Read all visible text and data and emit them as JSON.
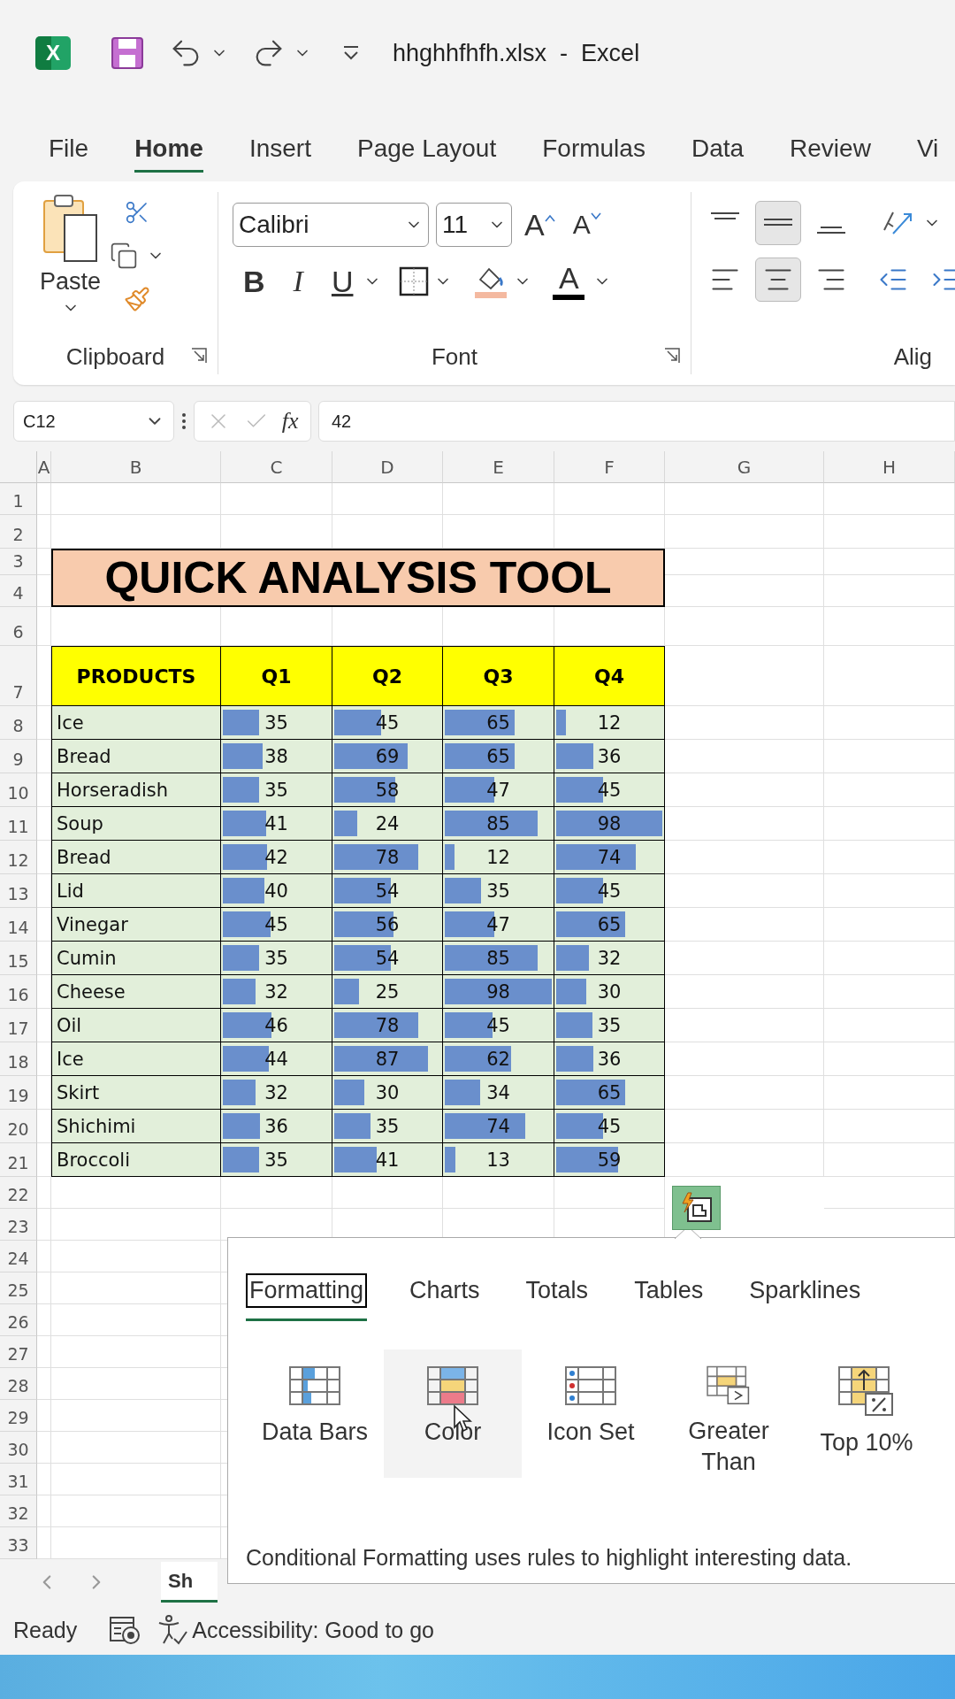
{
  "title_bar": {
    "logo_text": "X",
    "title": "hhghhfhfh.xlsx  -  Excel"
  },
  "ribbon_tabs": [
    {
      "label": "File",
      "selected": false
    },
    {
      "label": "Home",
      "selected": true
    },
    {
      "label": "Insert",
      "selected": false
    },
    {
      "label": "Page Layout",
      "selected": false
    },
    {
      "label": "Formulas",
      "selected": false
    },
    {
      "label": "Data",
      "selected": false
    },
    {
      "label": "Review",
      "selected": false
    },
    {
      "label": "Vi",
      "selected": false
    }
  ],
  "ribbon": {
    "clipboard": {
      "paste_label": "Paste",
      "group_label": "Clipboard"
    },
    "font": {
      "font_name": "Calibri",
      "font_size": "11",
      "grow": "A",
      "shrink": "A",
      "bold": "B",
      "italic": "I",
      "underline": "U",
      "font_color": "A",
      "group_label": "Font"
    },
    "alignment": {
      "group_label": "Alig"
    }
  },
  "formula_bar": {
    "name_box": "C12",
    "fx": "fx",
    "value": "42"
  },
  "sheet": {
    "columns": [
      "A",
      "B",
      "C",
      "D",
      "E",
      "F",
      "G",
      "H"
    ],
    "rows": [
      "1",
      "2",
      "3",
      "4",
      "6",
      "7",
      "8",
      "9",
      "10",
      "11",
      "12",
      "13",
      "14",
      "15",
      "16",
      "17",
      "18",
      "19",
      "20",
      "21",
      "22",
      "23",
      "24",
      "25",
      "26",
      "27",
      "28",
      "29",
      "30",
      "31",
      "32",
      "33"
    ],
    "title": "QUICK ANALYSIS TOOL",
    "headers": [
      "PRODUCTS",
      "Q1",
      "Q2",
      "Q3",
      "Q4"
    ],
    "table": [
      {
        "product": "Ice",
        "cells": [
          {
            "value": "35",
            "level": 0.36
          },
          {
            "value": "45",
            "level": 0.46
          },
          {
            "value": "65",
            "level": 0.66
          },
          {
            "value": "12",
            "level": 0.12
          }
        ]
      },
      {
        "product": "Bread",
        "cells": [
          {
            "value": "38",
            "level": 0.39
          },
          {
            "value": "69",
            "level": 0.7
          },
          {
            "value": "65",
            "level": 0.66
          },
          {
            "value": "36",
            "level": 0.37
          }
        ]
      },
      {
        "product": "Horseradish",
        "cells": [
          {
            "value": "35",
            "level": 0.36
          },
          {
            "value": "58",
            "level": 0.59
          },
          {
            "value": "47",
            "level": 0.48
          },
          {
            "value": "45",
            "level": 0.46
          }
        ]
      },
      {
        "product": "Soup",
        "cells": [
          {
            "value": "41",
            "level": 0.42
          },
          {
            "value": "24",
            "level": 0.24
          },
          {
            "value": "85",
            "level": 0.87
          },
          {
            "value": "98",
            "level": 1
          }
        ]
      },
      {
        "product": "Bread",
        "cells": [
          {
            "value": "42",
            "level": 0.43
          },
          {
            "value": "78",
            "level": 0.8
          },
          {
            "value": "12",
            "level": 0.12
          },
          {
            "value": "74",
            "level": 0.76
          }
        ]
      },
      {
        "product": "Lid",
        "cells": [
          {
            "value": "40",
            "level": 0.41
          },
          {
            "value": "54",
            "level": 0.55
          },
          {
            "value": "35",
            "level": 0.36
          },
          {
            "value": "45",
            "level": 0.46
          }
        ]
      },
      {
        "product": "Vinegar",
        "cells": [
          {
            "value": "45",
            "level": 0.46
          },
          {
            "value": "56",
            "level": 0.57
          },
          {
            "value": "47",
            "level": 0.48
          },
          {
            "value": "65",
            "level": 0.66
          }
        ]
      },
      {
        "product": "Cumin",
        "cells": [
          {
            "value": "35",
            "level": 0.36
          },
          {
            "value": "54",
            "level": 0.55
          },
          {
            "value": "85",
            "level": 0.87
          },
          {
            "value": "32",
            "level": 0.33
          }
        ]
      },
      {
        "product": "Cheese",
        "cells": [
          {
            "value": "32",
            "level": 0.33
          },
          {
            "value": "25",
            "level": 0.26
          },
          {
            "value": "98",
            "level": 1
          },
          {
            "value": "30",
            "level": 0.31
          }
        ]
      },
      {
        "product": "Oil",
        "cells": [
          {
            "value": "46",
            "level": 0.47
          },
          {
            "value": "78",
            "level": 0.8
          },
          {
            "value": "45",
            "level": 0.46
          },
          {
            "value": "35",
            "level": 0.36
          }
        ]
      },
      {
        "product": "Ice",
        "cells": [
          {
            "value": "44",
            "level": 0.45
          },
          {
            "value": "87",
            "level": 0.89
          },
          {
            "value": "62",
            "level": 0.63
          },
          {
            "value": "36",
            "level": 0.37
          }
        ]
      },
      {
        "product": "Skirt",
        "cells": [
          {
            "value": "32",
            "level": 0.33
          },
          {
            "value": "30",
            "level": 0.31
          },
          {
            "value": "34",
            "level": 0.35
          },
          {
            "value": "65",
            "level": 0.66
          }
        ]
      },
      {
        "product": "Shichimi",
        "cells": [
          {
            "value": "36",
            "level": 0.37
          },
          {
            "value": "35",
            "level": 0.36
          },
          {
            "value": "74",
            "level": 0.76
          },
          {
            "value": "45",
            "level": 0.46
          }
        ]
      },
      {
        "product": "Broccoli",
        "cells": [
          {
            "value": "35",
            "level": 0.36
          },
          {
            "value": "41",
            "level": 0.42
          },
          {
            "value": "13",
            "level": 0.13
          },
          {
            "value": "59",
            "level": 0.6
          }
        ]
      }
    ]
  },
  "quick_analysis": {
    "tabs": [
      {
        "label": "Formatting",
        "selected": true
      },
      {
        "label": "Charts",
        "selected": false
      },
      {
        "label": "Totals",
        "selected": false
      },
      {
        "label": "Tables",
        "selected": false
      },
      {
        "label": "Sparklines",
        "selected": false
      }
    ],
    "options": [
      {
        "label": "Data Bars",
        "kind": "data-bars",
        "hovered": false
      },
      {
        "label": "Color",
        "kind": "color-scale",
        "hovered": true
      },
      {
        "label": "Icon Set",
        "kind": "icon-set",
        "hovered": false
      },
      {
        "label": "Greater Than",
        "kind": "greater-than",
        "hovered": false
      },
      {
        "label": "Top 10%",
        "kind": "top-percent",
        "hovered": false
      }
    ],
    "description": "Conditional Formatting uses rules to highlight interesting data."
  },
  "sheet_tabs": [
    {
      "label": "Sh",
      "selected": true
    }
  ],
  "status_bar": {
    "ready": "Ready",
    "accessibility": "Accessibility: Good to go"
  }
}
